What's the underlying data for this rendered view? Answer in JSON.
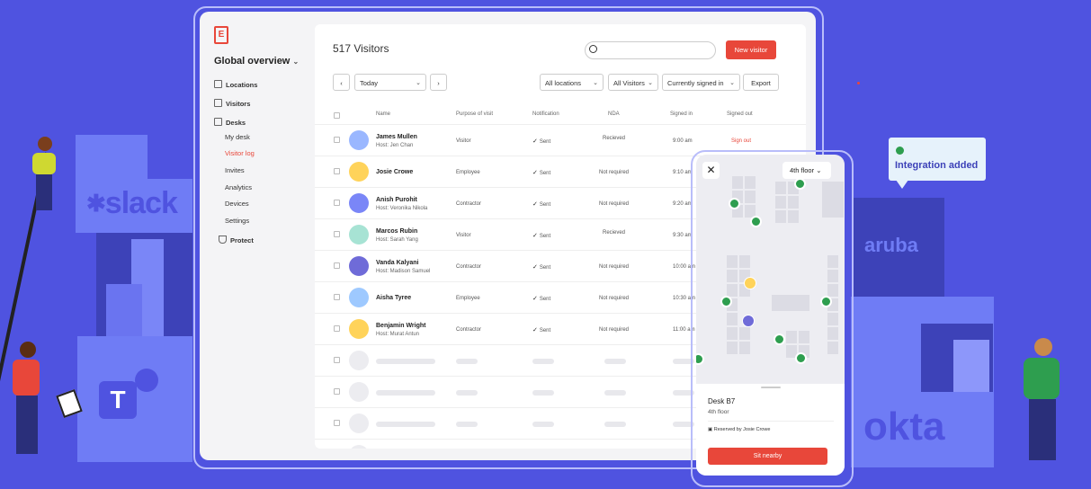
{
  "app": {
    "sidebar_title": "Global overview",
    "nav": [
      "Locations",
      "Visitors",
      "Desks",
      "My desk",
      "Visitor log",
      "Invites",
      "Analytics",
      "Devices",
      "Settings",
      "Protect"
    ]
  },
  "header": {
    "title": "517 Visitors",
    "search_placeholder": "",
    "new_visitor": "New visitor"
  },
  "filters": {
    "date": "Today",
    "locations": "All locations",
    "visitors": "All Visitors",
    "status": "Currently signed in",
    "export": "Export"
  },
  "table": {
    "columns": [
      "Name",
      "Purpose of visit",
      "Notification",
      "NDA",
      "Signed in",
      "Signed out"
    ],
    "rows": [
      {
        "name": "James Mullen",
        "host": "Host: Jen Chan",
        "purpose": "Visitor",
        "notification": "Sent",
        "nda": "Recieved",
        "signed_in": "9:00 am",
        "signed_out": "Sign out"
      },
      {
        "name": "Josie Crowe",
        "host": "",
        "purpose": "Employee",
        "notification": "Sent",
        "nda": "Not required",
        "signed_in": "9:10 am",
        "signed_out": ""
      },
      {
        "name": "Anish Purohit",
        "host": "Host: Veronika Nikola",
        "purpose": "Contractor",
        "notification": "Sent",
        "nda": "Not required",
        "signed_in": "9:20 am",
        "signed_out": ""
      },
      {
        "name": "Marcos Rubin",
        "host": "Host: Sarah Yang",
        "purpose": "Visitor",
        "notification": "Sent",
        "nda": "Recieved",
        "signed_in": "9:30 am",
        "signed_out": ""
      },
      {
        "name": "Vanda Kalyani",
        "host": "Host: Madison Samuel",
        "purpose": "Contractor",
        "notification": "Sent",
        "nda": "Not required",
        "signed_in": "10:00 am",
        "signed_out": ""
      },
      {
        "name": "Aisha Tyree",
        "host": "",
        "purpose": "Employee",
        "notification": "Sent",
        "nda": "Not required",
        "signed_in": "10:30 am",
        "signed_out": ""
      },
      {
        "name": "Benjamin Wright",
        "host": "Host: Murat Antun",
        "purpose": "Contractor",
        "notification": "Sent",
        "nda": "Not required",
        "signed_in": "11:00 am",
        "signed_out": ""
      }
    ]
  },
  "phone": {
    "floor": "4th floor",
    "desk_name": "Desk B7",
    "desk_floor": "4th floor",
    "reserved": "Reserved by Josie Crowe",
    "cta": "Sit nearby"
  },
  "integrations": {
    "badge": "Integration added",
    "slack": "slack",
    "aruba": "aruba",
    "okta": "okta",
    "teams": "T"
  },
  "colors": {
    "background": "#4f53e0",
    "accent": "#e8473a",
    "success": "#2e9e4f"
  }
}
